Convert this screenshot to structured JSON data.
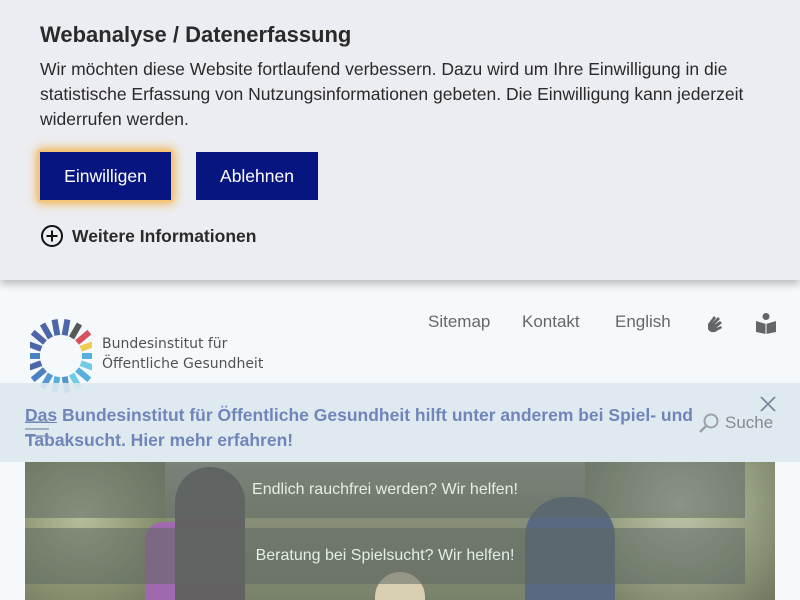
{
  "consent": {
    "title": "Webanalyse / Datenerfassung",
    "body": "Wir möchten diese Website fortlaufend verbessern. Dazu wird um Ihre Einwilligung in die statistische Erfassung von Nutzungsinformationen gebeten. Die Einwilligung kann jederzeit widerrufen werden.",
    "accept_label": "Einwilligen",
    "decline_label": "Ablehnen",
    "more_info_label": "Weitere Informationen",
    "more_info_icon": "plus-circle-icon"
  },
  "header": {
    "logo_line1": "Bundesinstitut für",
    "logo_line2": "Öffentliche Gesundheit",
    "nav": {
      "sitemap": "Sitemap",
      "kontakt": "Kontakt",
      "english": "English"
    },
    "icons": [
      "sign-language-icon",
      "easy-language-icon"
    ],
    "search_label": "Suche"
  },
  "info_strip": {
    "link_word": "Das",
    "text": " Bundesinstitut für Öffentliche Gesundheit hilft unter anderem bei Spiel- und Tabaksucht. Hier mehr erfahren!"
  },
  "hero": {
    "cta1": "Endlich rauchfrei werden? Wir helfen!",
    "cta2": "Beratung bei Spielsucht? Wir helfen!"
  },
  "colors": {
    "button_bg": "#071581",
    "accept_focus": "#f2a93b",
    "banner_bg": "#ecedf2",
    "info_text": "#4d66a8"
  }
}
